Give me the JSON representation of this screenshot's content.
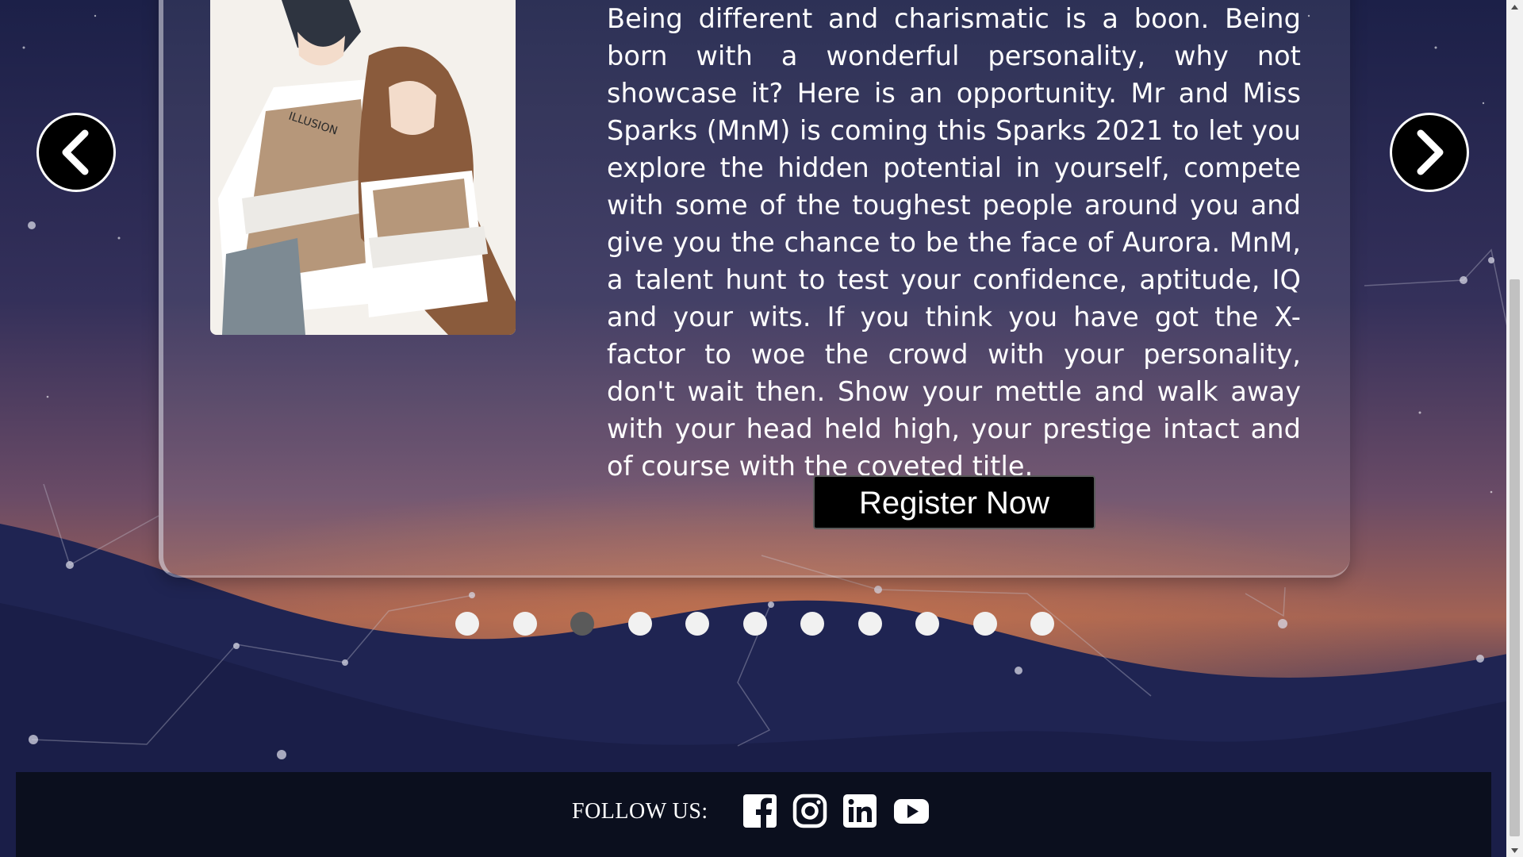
{
  "event": {
    "description": "Being different and charismatic is a boon. Being born with a wonderful personality, why not showcase it? Here is an opportunity. Mr and Miss Sparks (MnM) is coming this Sparks 2021 to let you explore the hidden potential in yourself, compete with some of the toughest people around you and give you the chance to be the face of Aurora. MnM, a talent hunt to test your confidence, aptitude, IQ and your wits. If you think you have got the X-factor to woe the crowd with your personality, don't wait then. Show your mettle and walk away with your head held high, your prestige intact and of course with the coveted title.",
    "register_label": "Register Now",
    "art_badge": "ILLUSION"
  },
  "carousel": {
    "prev_icon": "chevron-left-icon",
    "next_icon": "chevron-right-icon",
    "slide_count": 11,
    "active_slide": 3
  },
  "footer": {
    "follow_label": "FOLLOW US:",
    "social": [
      "facebook-icon",
      "instagram-icon",
      "linkedin-icon",
      "youtube-icon"
    ]
  },
  "colors": {
    "background": "#1a1f45",
    "dot": "#f1f1f1",
    "dot_active": "#5a5a5a",
    "footer": "#0b0f1e"
  }
}
